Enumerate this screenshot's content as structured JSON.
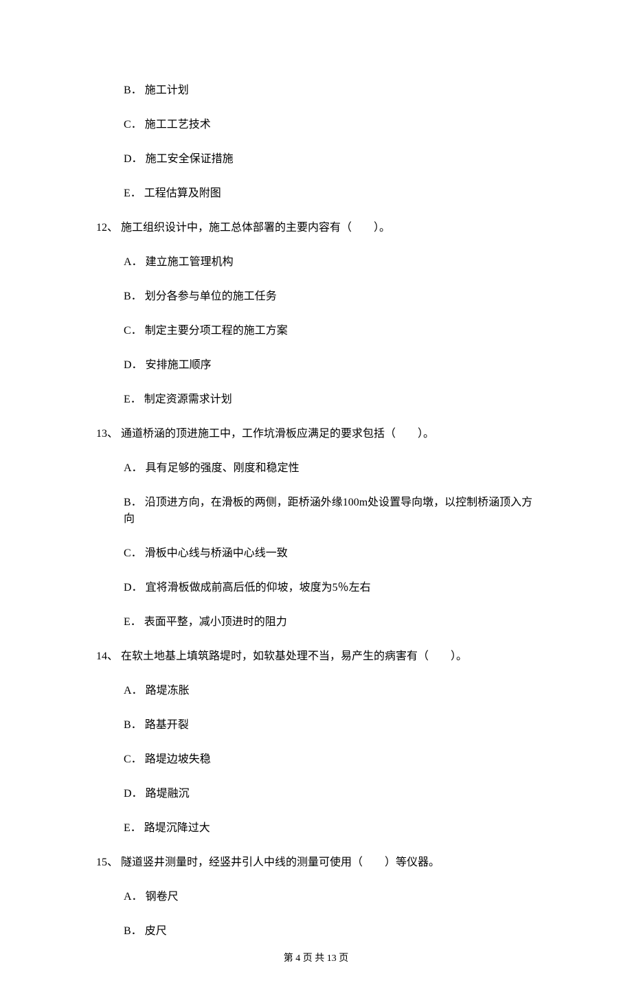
{
  "orphan_options": [
    {
      "letter": "B．",
      "text": "施工计划"
    },
    {
      "letter": "C．",
      "text": "施工工艺技术"
    },
    {
      "letter": "D．",
      "text": "施工安全保证措施"
    },
    {
      "letter": "E．",
      "text": "工程估算及附图"
    }
  ],
  "questions": [
    {
      "num": "12、",
      "stem": "施工组织设计中，施工总体部署的主要内容有（　　）。",
      "options": [
        {
          "letter": "A．",
          "text": "建立施工管理机构"
        },
        {
          "letter": "B．",
          "text": "划分各参与单位的施工任务"
        },
        {
          "letter": "C．",
          "text": "制定主要分项工程的施工方案"
        },
        {
          "letter": "D．",
          "text": "安排施工顺序"
        },
        {
          "letter": "E．",
          "text": "制定资源需求计划"
        }
      ]
    },
    {
      "num": "13、",
      "stem": "通道桥涵的顶进施工中，工作坑滑板应满足的要求包括（　　）。",
      "options": [
        {
          "letter": "A．",
          "text": "具有足够的强度、刚度和稳定性"
        },
        {
          "letter": "B．",
          "text": "沿顶进方向，在滑板的两侧，距桥涵外缘100m处设置导向墩，以控制桥涵顶入方向"
        },
        {
          "letter": "C．",
          "text": "滑板中心线与桥涵中心线一致"
        },
        {
          "letter": "D．",
          "text": "宜将滑板做成前高后低的仰坡，坡度为5％左右"
        },
        {
          "letter": "E．",
          "text": "表面平整，减小顶进时的阻力"
        }
      ]
    },
    {
      "num": "14、",
      "stem": "在软土地基上填筑路堤时，如软基处理不当，易产生的病害有（　　）。",
      "options": [
        {
          "letter": "A．",
          "text": "路堤冻胀"
        },
        {
          "letter": "B．",
          "text": "路基开裂"
        },
        {
          "letter": "C．",
          "text": "路堤边坡失稳"
        },
        {
          "letter": "D．",
          "text": "路堤融沉"
        },
        {
          "letter": "E．",
          "text": "路堤沉降过大"
        }
      ]
    },
    {
      "num": "15、",
      "stem": "隧道竖井测量时，经竖井引人中线的测量可使用（　　）等仪器。",
      "options": [
        {
          "letter": "A．",
          "text": "钢卷尺"
        },
        {
          "letter": "B．",
          "text": "皮尺"
        }
      ]
    }
  ],
  "footer": "第 4 页 共 13 页"
}
